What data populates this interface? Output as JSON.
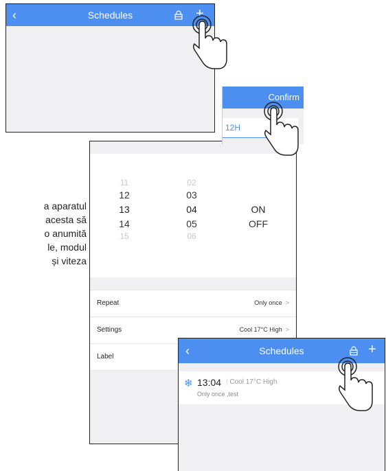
{
  "screen1": {
    "title": "Schedules",
    "back_icon": "back-chevron-icon",
    "lock_icon": "home-lock-icon",
    "add_icon": "plus-icon"
  },
  "confirm_panel": {
    "confirm_label": "Confirm",
    "format_label": "12H"
  },
  "picker": {
    "hours": [
      "11",
      "12",
      "13",
      "14",
      "15"
    ],
    "minutes": [
      "02",
      "03",
      "04",
      "05",
      "06"
    ],
    "states": [
      "ON",
      "OFF"
    ],
    "rows": [
      {
        "label": "Repeat",
        "value": "Only once"
      },
      {
        "label": "Settings",
        "value": "Cool 17°C High"
      },
      {
        "label": "Label",
        "value": ""
      }
    ]
  },
  "side_text": {
    "lines": [
      "a aparatul",
      "acesta să",
      "o anumită",
      "le, modul",
      "și viteza"
    ]
  },
  "screen3": {
    "title": "Schedules",
    "item": {
      "time": "13:04",
      "mode": "Cool 17°C High",
      "sub": "Only once ,test",
      "icon": "snowflake-icon"
    }
  },
  "colors": {
    "accent": "#4d8ff0",
    "background": "#f0f0f2"
  }
}
